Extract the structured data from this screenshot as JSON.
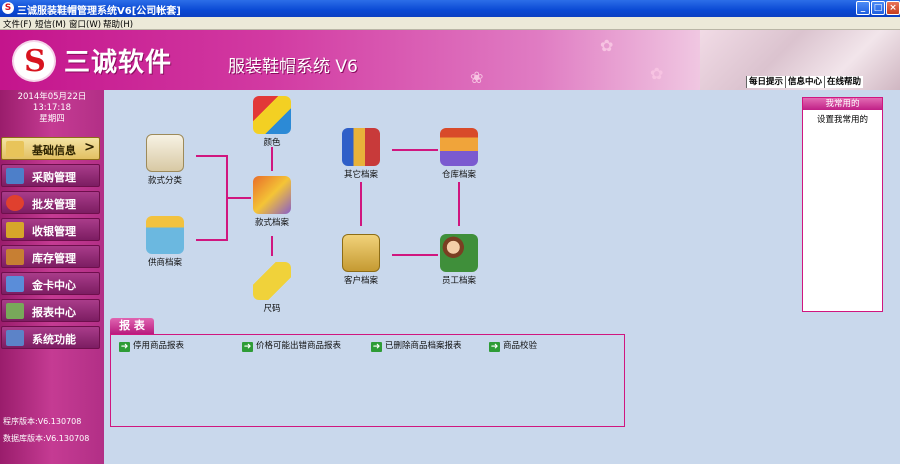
{
  "window": {
    "title": "三诚服装鞋帽管理系统V6[公司帐套]",
    "app_icon": "S"
  },
  "menu": [
    "文件(F)",
    "短信(M)",
    "窗口(W)",
    "帮助(H)"
  ],
  "banner": {
    "brand": "三诚软件",
    "product": "服装鞋帽系统 V6",
    "links": [
      "每日提示",
      "信息中心",
      "在线帮助"
    ]
  },
  "sidebar": {
    "date": "2014年05月22日",
    "time": "13:17:18",
    "weekday": "星期四",
    "items": [
      {
        "label": "基础信息",
        "icon": "clipboard-icon",
        "color": "#e8c45a"
      },
      {
        "label": "采购管理",
        "icon": "cart-icon",
        "color": "#4d7fc9"
      },
      {
        "label": "批发管理",
        "icon": "discount-icon",
        "color": "#e0402e"
      },
      {
        "label": "收银管理",
        "icon": "yen-icon",
        "color": "#d6a62a"
      },
      {
        "label": "库存管理",
        "icon": "warehouse-icon",
        "color": "#c77f33"
      },
      {
        "label": "金卡中心",
        "icon": "card-icon",
        "color": "#5a8dd9"
      },
      {
        "label": "报表中心",
        "icon": "report-icon",
        "color": "#78a85a"
      },
      {
        "label": "系统功能",
        "icon": "folder-icon",
        "color": "#5c83c8"
      }
    ],
    "program_version": "程序版本:V6.130708",
    "db_version": "数据库版本:V6.130708"
  },
  "nodes": {
    "style_category": "款式分类",
    "color": "颜色",
    "style_archive": "款式档案",
    "supplier_archive": "供商档案",
    "size": "尺码",
    "other_archive": "其它档案",
    "warehouse_archive": "仓库档案",
    "customer_archive": "客户档案",
    "employee_archive": "员工档案"
  },
  "favorites": {
    "header": "我常用的",
    "setting": "设置我常用的"
  },
  "reports": {
    "tab": "报 表",
    "items": [
      "停用商品报表",
      "价格可能出错商品报表",
      "已删除商品档案报表",
      "商品校验"
    ]
  }
}
